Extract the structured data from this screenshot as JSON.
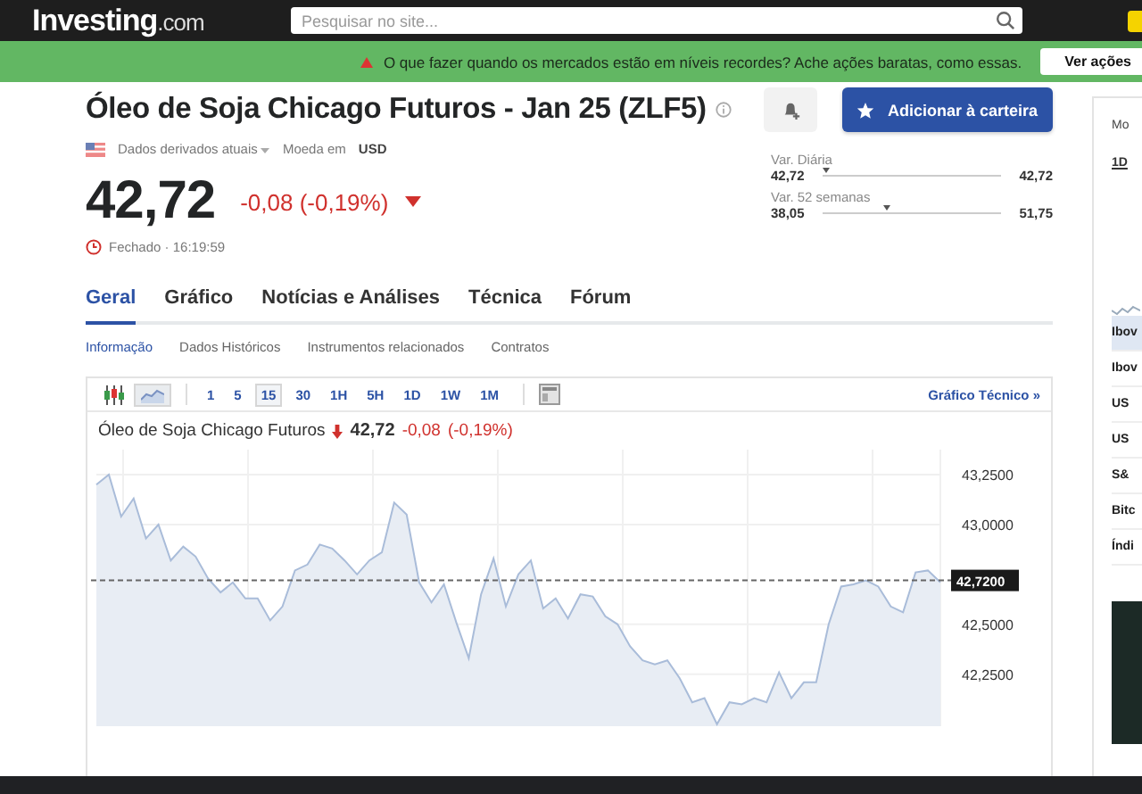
{
  "header": {
    "logo": {
      "name": "Investing",
      "suffix": ".com"
    },
    "search": {
      "placeholder": "Pesquisar no site..."
    }
  },
  "promo": {
    "text": "O que fazer quando os mercados estão em níveis recordes? Ache ações baratas, como essas.",
    "button": "Ver ações"
  },
  "instrument": {
    "title": "Óleo de Soja Chicago Futuros - Jan 25 (ZLF5)",
    "data_type": "Dados derivados atuais",
    "currency_label": "Moeda em",
    "currency": "USD",
    "price": "42,72",
    "change": "-0,08 (-0,19%)",
    "status": "Fechado · 16:19:59"
  },
  "actions": {
    "portfolio_button": "Adicionar à carteira"
  },
  "ranges": [
    {
      "label": "Var. Diária",
      "low": "42,72",
      "high": "42,72",
      "level": 0.0
    },
    {
      "label": "Var. 52 semanas",
      "low": "38,05",
      "high": "51,75",
      "level": 0.34
    }
  ],
  "tabs": [
    {
      "label": "Geral",
      "selected": true
    },
    {
      "label": "Gráfico",
      "selected": false
    },
    {
      "label": "Notícias e Análises",
      "selected": false
    },
    {
      "label": "Técnica",
      "selected": false
    },
    {
      "label": "Fórum",
      "selected": false
    }
  ],
  "subtabs": [
    {
      "label": "Informação",
      "selected": true
    },
    {
      "label": "Dados Históricos",
      "selected": false
    },
    {
      "label": "Instrumentos relacionados",
      "selected": false
    },
    {
      "label": "Contratos",
      "selected": false
    }
  ],
  "chart_panel": {
    "chart_types": [
      {
        "kind": "candles",
        "selected": false
      },
      {
        "kind": "area",
        "selected": true
      }
    ],
    "intervals": [
      {
        "label": "1",
        "selected": false
      },
      {
        "label": "5",
        "selected": false
      },
      {
        "label": "15",
        "selected": true
      },
      {
        "label": "30",
        "selected": false
      },
      {
        "label": "1H",
        "selected": false
      },
      {
        "label": "5H",
        "selected": false
      },
      {
        "label": "1D",
        "selected": false
      },
      {
        "label": "1W",
        "selected": false
      },
      {
        "label": "1M",
        "selected": false
      }
    ],
    "technical_link": "Gráfico Técnico »",
    "chart_title": "Óleo de Soja Chicago Futuros",
    "price": "42,72",
    "change": "-0,08",
    "change_pct": "(-0,19%)",
    "axis_labels": [
      "43,2500",
      "43,0000",
      "42,5000",
      "42,2500"
    ],
    "last_price_tag": "42,7200"
  },
  "sidebar": {
    "heading": "Mo",
    "period": "1D",
    "rows": [
      {
        "label": "Ibov",
        "selected": true
      },
      {
        "label": "Ibov",
        "selected": false
      },
      {
        "label": "US",
        "selected": false
      },
      {
        "label": "US",
        "selected": false
      },
      {
        "label": "S&",
        "selected": false
      },
      {
        "label": "Bitc",
        "selected": false
      },
      {
        "label": "Índi",
        "selected": false
      }
    ]
  }
}
